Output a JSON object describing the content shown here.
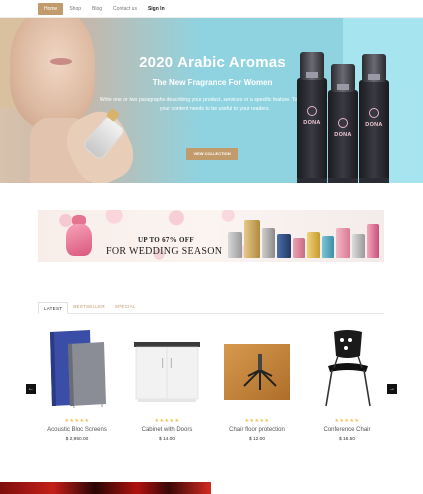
{
  "nav": {
    "items": [
      {
        "label": "Home"
      },
      {
        "label": "Shop"
      },
      {
        "label": "Blog"
      },
      {
        "label": "Contact us"
      },
      {
        "label": "Sign In"
      }
    ]
  },
  "hero": {
    "title": "2020 Arabic Aromas",
    "subtitle": "The New Fragrance For Women",
    "description": "Write one or two paragraphs describing your product, services or a specific feature. To be successful your content needs to be useful to your readers.",
    "button_label": "VIEW COLLECTION",
    "bottle_label": "DONA"
  },
  "banner": {
    "line1": "UP TO 67% OFF",
    "line2": "FOR WEDDING SEASON"
  },
  "tabs": [
    {
      "label": "LATEST"
    },
    {
      "label": "BESTSELLER"
    },
    {
      "label": "SPECIAL"
    }
  ],
  "products": [
    {
      "name": "Acoustic Bloc Screens",
      "price": "$ 2,950.00",
      "stars": "★★★★★"
    },
    {
      "name": "Cabinet with Doors",
      "price": "$ 14.00",
      "stars": "★★★★★"
    },
    {
      "name": "Chair floor protection",
      "price": "$ 12.00",
      "stars": "★★★★★"
    },
    {
      "name": "Conference Chair",
      "price": "$ 16.50",
      "stars": "★★★★★"
    }
  ],
  "carousel": {
    "prev": "←",
    "next": "→"
  },
  "colors": {
    "accent": "#c19b6c",
    "hero_bg": "#8fd3e0",
    "star": "#f0c050"
  }
}
